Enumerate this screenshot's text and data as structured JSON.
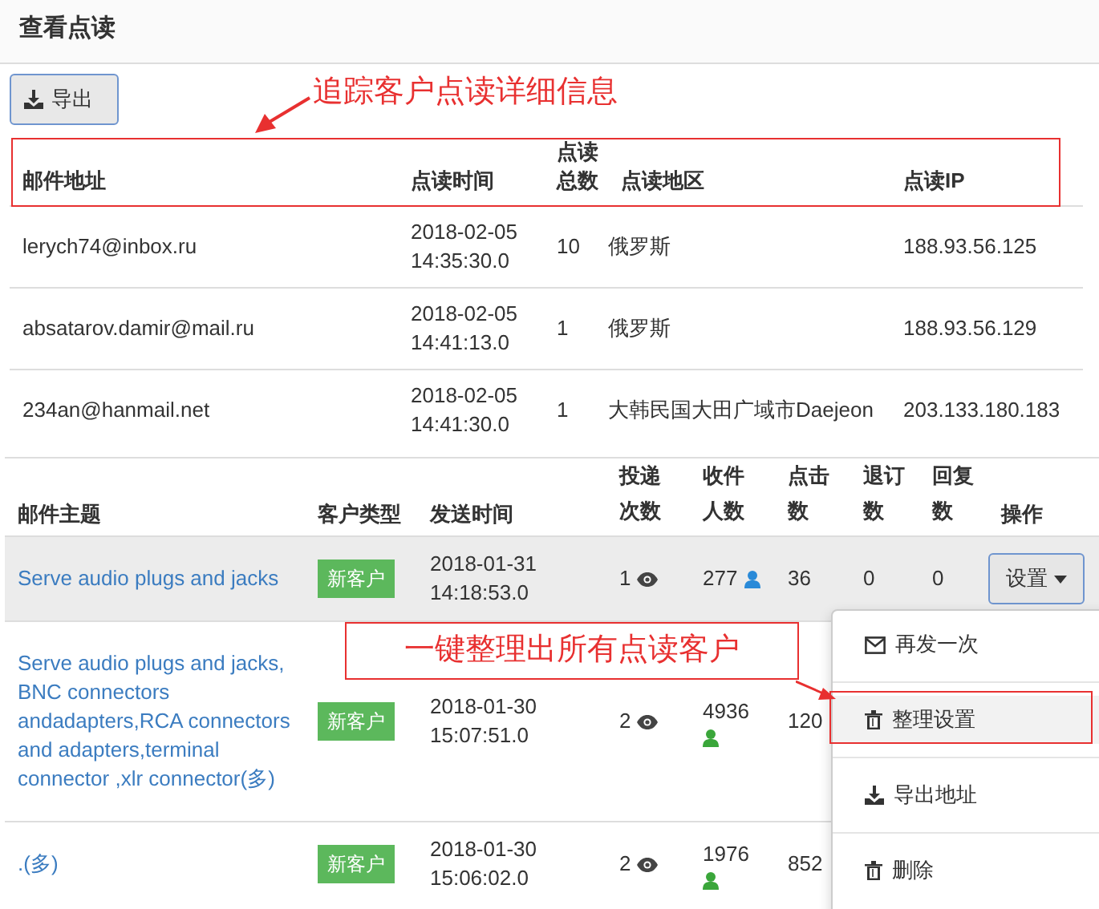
{
  "title": "查看点读",
  "export_button": {
    "label": "导出"
  },
  "annotations": [
    {
      "text": "追踪客户点读详细信息"
    },
    {
      "text": "一键整理出所有点读客户"
    }
  ],
  "clicks_table": {
    "columns": [
      "邮件地址",
      "点读时间",
      "点读总数",
      "点读地区",
      "点读IP"
    ],
    "rows": [
      {
        "email": "lerych74@inbox.ru",
        "time": "2018-02-05 14:35:30.0",
        "count": "10",
        "region": "俄罗斯",
        "ip": "188.93.56.125"
      },
      {
        "email": "absatarov.damir@mail.ru",
        "time": "2018-02-05 14:41:13.0",
        "count": "1",
        "region": "俄罗斯",
        "ip": "188.93.56.129"
      },
      {
        "email": "234an@hanmail.net",
        "time": "2018-02-05 14:41:30.0",
        "count": "1",
        "region": "大韩民国大田广域市Daejeon",
        "ip": "203.133.180.183"
      }
    ]
  },
  "mail_table": {
    "columns": [
      "邮件主题",
      "客户类型",
      "发送时间",
      "投递次数",
      "收件人数",
      "点击数",
      "退订数",
      "回复数",
      "操作"
    ],
    "rows": [
      {
        "subject": "Serve audio plugs and jacks",
        "type": "新客户",
        "time": "2018-01-31 14:18:53.0",
        "sends": "1",
        "recipients": "277",
        "color": "#2a8ad8",
        "clicks": "36",
        "unsubscribes": "0",
        "replies": "0",
        "selected": true,
        "action": "设置"
      },
      {
        "subject": "Serve audio plugs and jacks, BNC connectors andadapters,RCA connectors and adapters,terminal connector ,xlr connector(多)",
        "type": "新客户",
        "time": "2018-01-30 15:07:51.0",
        "sends": "2",
        "recipients": "4936",
        "color": "#3aa63a",
        "clicks": "120",
        "selected": false
      },
      {
        "subject": ".(多)",
        "type": "新客户",
        "time": "2018-01-30 15:06:02.0",
        "sends": "2",
        "recipients": "1976",
        "color": "#3aa63a",
        "clicks": "852",
        "selected": false
      }
    ]
  },
  "dropdown": {
    "items": [
      {
        "kind": "mail",
        "label": "再发一次",
        "selected": false
      },
      {
        "kind": "trash",
        "label": "整理设置",
        "selected": true
      },
      {
        "kind": "download",
        "label": "导出地址",
        "selected": false
      },
      {
        "kind": "trash",
        "label": "删除",
        "selected": false
      }
    ]
  }
}
